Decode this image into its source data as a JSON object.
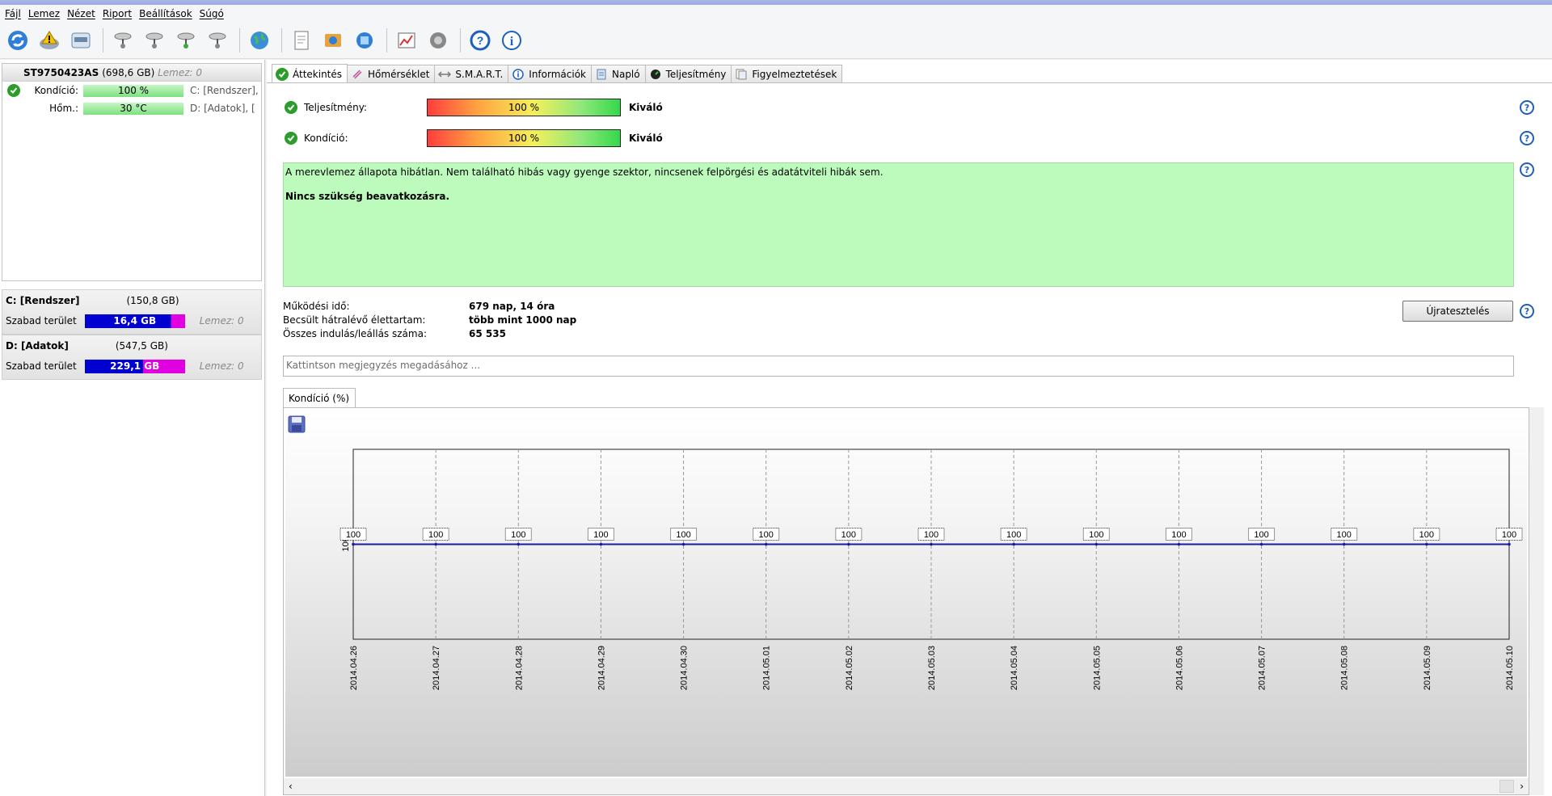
{
  "menu": [
    "Fájl",
    "Lemez",
    "Nézet",
    "Riport",
    "Beállítások",
    "Súgó"
  ],
  "toolbar": {
    "icons": [
      "refresh-icon",
      "warning-icon",
      "disk-icon",
      "satellite-1-icon",
      "satellite-2-icon",
      "satellite-3-icon",
      "satellite-4-icon",
      "globe-icon",
      "report-icon",
      "sync-icon",
      "network-icon",
      "chart-icon",
      "sound-icon",
      "help-icon",
      "info-icon"
    ]
  },
  "disk": {
    "model": "ST9750423AS",
    "size": "(698,6 GB)",
    "lemez": "Lemez: 0",
    "kondicio_label": "Kondíció:",
    "kondicio_value": "100 %",
    "kondicio_part": "C: [Rendszer],",
    "hom_label": "Hőm.:",
    "hom_value": "30 °C",
    "hom_part": "D: [Adatok], [",
    "status_color": "#2a9d2a"
  },
  "volumes": [
    {
      "name": "C: [Rendszer]",
      "size": "(150,8 GB)",
      "free_label": "Szabad terület",
      "free": "16,4 GB",
      "lemez": "Lemez: 0",
      "free_fraction": 0.89
    },
    {
      "name": "D: [Adatok]",
      "size": "(547,5 GB)",
      "free_label": "Szabad terület",
      "free": "229,1 GB",
      "lemez": "Lemez: 0",
      "free_fraction": 0.58
    }
  ],
  "tabs": [
    {
      "label": "Áttekintés",
      "icon": "check-icon",
      "active": true
    },
    {
      "label": "Hőmérséklet",
      "icon": "thermometer-icon"
    },
    {
      "label": "S.M.A.R.T.",
      "icon": "smart-icon"
    },
    {
      "label": "Információk",
      "icon": "info-icon"
    },
    {
      "label": "Napló",
      "icon": "log-icon"
    },
    {
      "label": "Teljesítmény",
      "icon": "performance-icon"
    },
    {
      "label": "Figyelmeztetések",
      "icon": "alerts-icon"
    }
  ],
  "overview": {
    "performance_label": "Teljesítmény:",
    "performance_value": "100 %",
    "performance_rating": "Kiváló",
    "condition_label": "Kondíció:",
    "condition_value": "100 %",
    "condition_rating": "Kiváló",
    "status_text": "A merevlemez állapota hibátlan. Nem található hibás vagy gyenge szektor, nincsenek felpörgési és adatátviteli hibák sem.",
    "action_text": "Nincs szükség beavatkozásra.",
    "status_bg": "#bdfbbd"
  },
  "facts": [
    {
      "label": "Működési idő:",
      "value": "679 nap, 14 óra"
    },
    {
      "label": "Becsült hátralévő élettartam:",
      "value": "több mint 1000 nap"
    },
    {
      "label": "Összes indulás/leállás száma:",
      "value": "65 535"
    }
  ],
  "retest_label": "Újratesztelés",
  "note_placeholder": "Kattintson megjegyzés megadásához ...",
  "chart_tab": "Kondíció  (%)",
  "chart_data": {
    "type": "line",
    "x": [
      "2014.04.26",
      "2014.04.27",
      "2014.04.28",
      "2014.04.29",
      "2014.04.30",
      "2014.05.01",
      "2014.05.02",
      "2014.05.03",
      "2014.05.04",
      "2014.05.05",
      "2014.05.06",
      "2014.05.07",
      "2014.05.08",
      "2014.05.09",
      "2014.05.10"
    ],
    "series": [
      {
        "values": [
          100,
          100,
          100,
          100,
          100,
          100,
          100,
          100,
          100,
          100,
          100,
          100,
          100,
          100,
          100
        ]
      }
    ],
    "y_tick_labels": [
      "100"
    ],
    "ylim": [
      0,
      200
    ],
    "grid": "vertical dashed",
    "line_color": "#1a1aa0"
  }
}
